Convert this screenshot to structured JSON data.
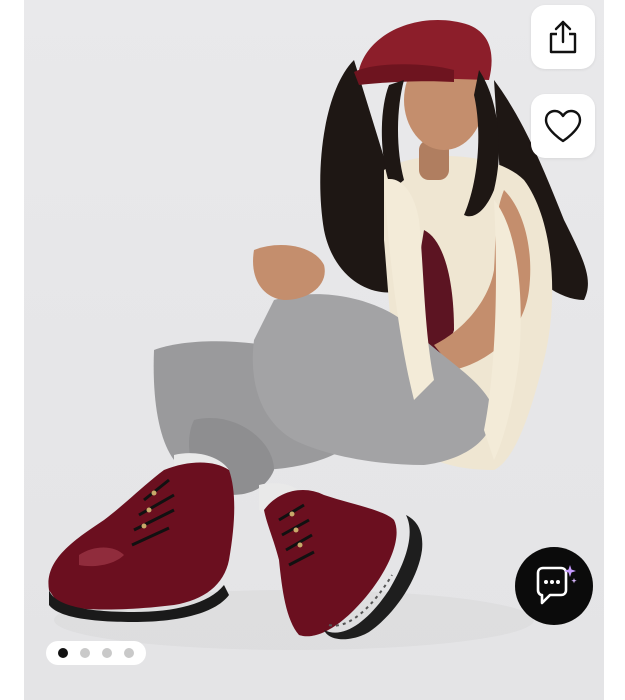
{
  "product_gallery": {
    "image_description_icon": "product-photo",
    "slide_count": 4,
    "active_slide": 1
  },
  "actions": {
    "share_icon": "share-icon",
    "favorite_icon": "heart-icon",
    "chat_icon": "chat-sparkle-icon"
  },
  "colors": {
    "background": "#e6e6e8",
    "boot": "#6b0f1f",
    "chat_button": "#0b0b0b",
    "sparkle": "#c79cff"
  }
}
